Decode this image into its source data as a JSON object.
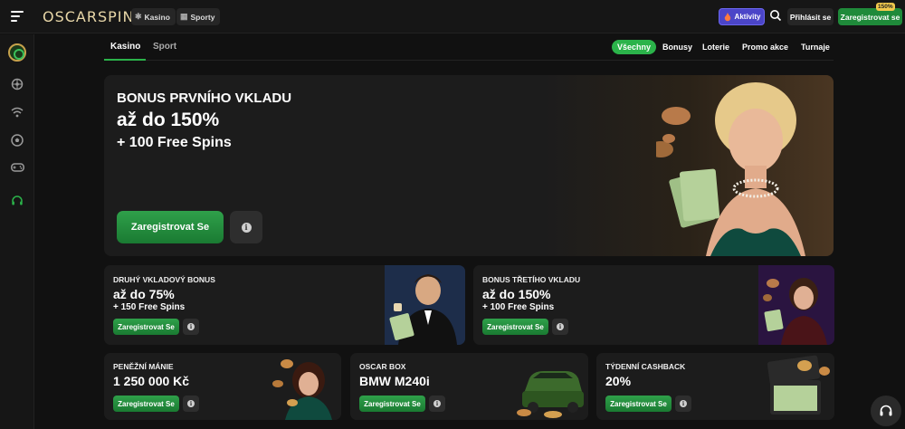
{
  "header": {
    "logo": "OSCARSPIN",
    "tabs": [
      {
        "label": "Kasino",
        "icon": "casino-chip-icon"
      },
      {
        "label": "Sporty",
        "icon": "sports-grid-icon"
      }
    ],
    "activity_label": "Aktivity",
    "login_label": "Přihlásit se",
    "register_label": "Zaregistrovat se",
    "register_badge": "150%"
  },
  "sidebar": {
    "icons": [
      "oscarspin-logo-icon",
      "slots-reel-icon",
      "live-signal-icon",
      "football-icon",
      "gamepad-icon",
      "support-headset-icon"
    ]
  },
  "subnav": {
    "tabs": [
      "Kasino",
      "Sport"
    ],
    "active_tab": "Kasino",
    "filters": [
      "Všechny",
      "Bonusy",
      "Loterie",
      "Promo akce",
      "Turnaje"
    ],
    "active_filter": "Všechny"
  },
  "hero": {
    "line1": "BONUS PRVNÍHO VKLADU",
    "line2": "až do 150%",
    "line3": "+ 100 Free Spins",
    "cta": "Zaregistrovat Se",
    "info": "i"
  },
  "cards": [
    {
      "title": "DRUHÝ VKLADOVÝ BONUS",
      "amount": "až do 75%",
      "extra": "+ 150 Free Spins",
      "cta": "Zaregistrovat Se",
      "info": "i"
    },
    {
      "title": "BONUS TŘETÍHO VKLADU",
      "amount": "až do 150%",
      "extra": "+ 100 Free Spins",
      "cta": "Zaregistrovat Se",
      "info": "i"
    },
    {
      "title": "PENĚŽNÍ MÁNIE",
      "amount": "1 250 000 Kč",
      "cta": "Zaregistrovat Se",
      "info": "i"
    },
    {
      "title": "OSCAR BOX",
      "amount": "BMW M240i",
      "cta": "Zaregistrovat Se",
      "info": "i"
    },
    {
      "title": "TÝDENNÍ CASHBACK",
      "amount": "20%",
      "cta": "Zaregistrovat Se",
      "info": "i"
    }
  ],
  "colors": {
    "accent_green": "#2bb34a",
    "activity_purple": "#4b45c8",
    "background": "#111111",
    "card": "#1c1c1c"
  }
}
